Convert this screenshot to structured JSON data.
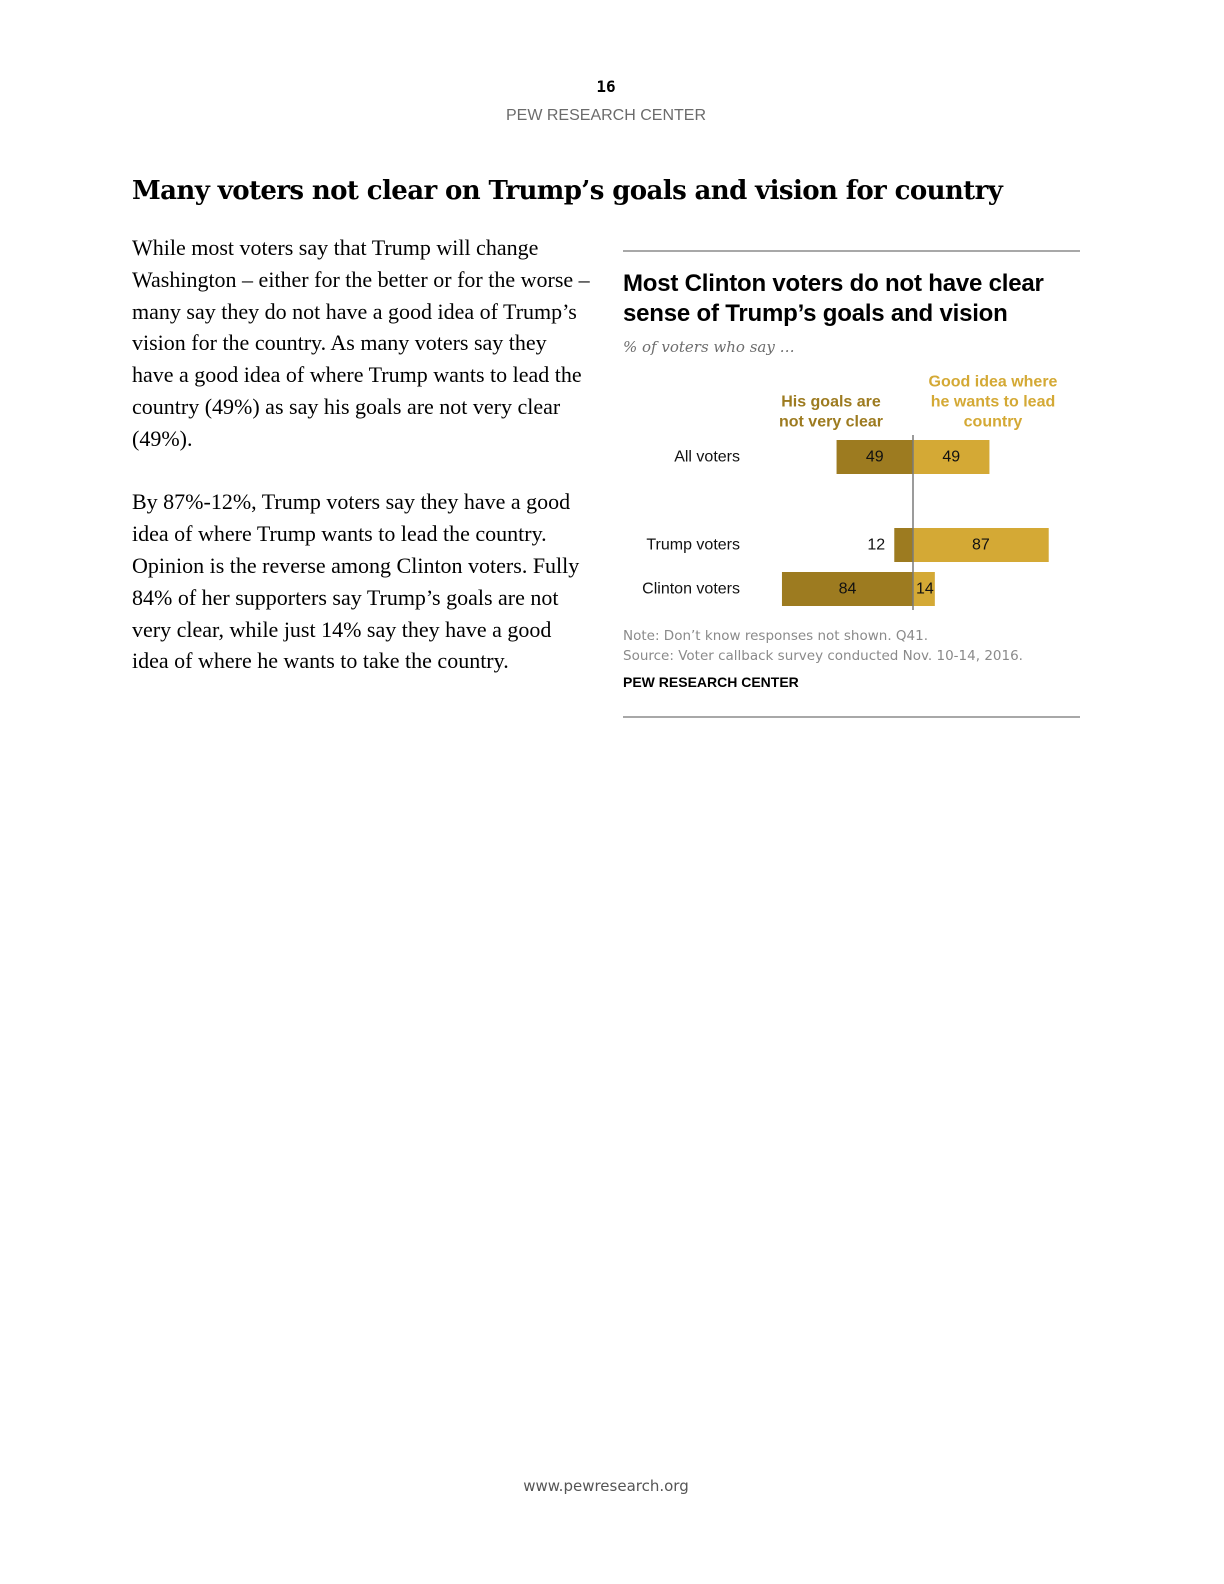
{
  "page": {
    "number": "16",
    "org": "PEW RESEARCH CENTER",
    "footer_url": "www.pewresearch.org"
  },
  "section": {
    "title": "Many voters not clear on Trump’s goals and vision for country",
    "paragraphs": [
      "While most voters say that Trump will change Washington – either for the better or for the worse – many say they do not have a good idea of Trump’s vision for the country. As many voters say they have a good idea of where Trump wants to lead the country (49%) as say his goals are not very clear (49%).",
      "By 87%-12%, Trump voters say they have a good idea of where Trump wants to lead the country. Opinion is the reverse among Clinton voters. Fully 84% of her supporters say Trump’s goals are not very clear, while just 14% say they have a good idea of where he wants to take the country."
    ]
  },
  "chart": {
    "note": "Note: Don’t know responses not shown. Q41.",
    "source": "Source: Voter callback survey conducted Nov. 10-14, 2016.",
    "org": "PEW RESEARCH CENTER"
  },
  "chart_data": {
    "type": "bar",
    "layout": "diverging",
    "title": "Most Clinton voters do not have clear sense of Trump’s goals and vision",
    "subtitle": "% of voters who say …",
    "categories": [
      "All voters",
      "Trump voters",
      "Clinton voters"
    ],
    "series": [
      {
        "name": "His goals are not very clear",
        "values": [
          49,
          12,
          84
        ],
        "color": "#9d7b20",
        "side": "left"
      },
      {
        "name": "Good idea where he wants to lead country",
        "values": [
          49,
          87,
          14
        ],
        "color": "#d4a935",
        "side": "right"
      }
    ],
    "grid": false
  }
}
